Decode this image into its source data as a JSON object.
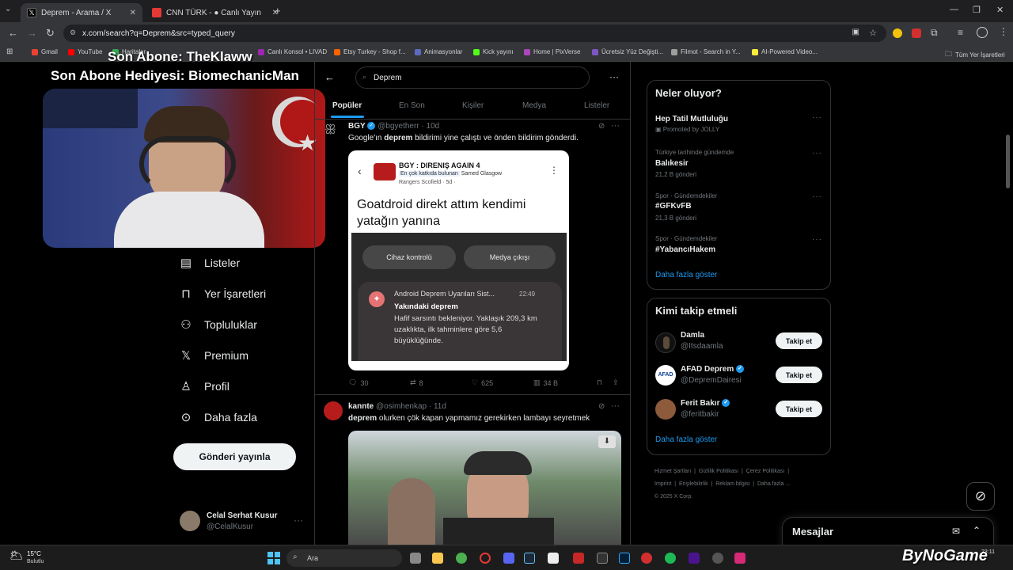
{
  "browser": {
    "tabs": [
      {
        "title": "Deprem - Arama / X",
        "active": true,
        "fav_color": "#000000"
      },
      {
        "title": "CNN TÜRK - ● Canlı Yayın",
        "active": false,
        "fav_color": "#e53935"
      }
    ],
    "url": "x.com/search?q=Deprem&src=typed_query",
    "bookmarks": [
      {
        "label": "Gmail",
        "color": "#ea4335"
      },
      {
        "label": "YouTube",
        "color": "#ff0000"
      },
      {
        "label": "Haritalar",
        "color": "#34a853"
      },
      {
        "label": "Canlı Konsol • LIVAD",
        "color": "#9c27b0"
      },
      {
        "label": "Etsy Turkey - Shop f...",
        "color": "#f56400"
      },
      {
        "label": "Animasyonlar",
        "color": "#5c6bc0"
      },
      {
        "label": "Kick yayını",
        "color": "#53fc18"
      },
      {
        "label": "Home | PixVerse",
        "color": "#ab47bc"
      },
      {
        "label": "Ücretsiz Yüz Değişti...",
        "color": "#7e57c2"
      },
      {
        "label": "Filmot - Search in Y...",
        "color": "#9e9e9e"
      },
      {
        "label": "AI-Powered Video...",
        "color": "#ffeb3b"
      }
    ],
    "all_bookmarks": "Tüm Yer İşaretleri"
  },
  "overlay": {
    "last_sub": "Son Abone: TheKlaww",
    "last_gift": "Son Abone Hediyesi: BiomechanicMan"
  },
  "nav": {
    "items": [
      {
        "label": "Listeler",
        "icon": "list-icon"
      },
      {
        "label": "Yer İşaretleri",
        "icon": "bookmark-icon"
      },
      {
        "label": "Topluluklar",
        "icon": "communities-icon"
      },
      {
        "label": "Premium",
        "icon": "x-logo-icon"
      },
      {
        "label": "Profil",
        "icon": "profile-icon"
      },
      {
        "label": "Daha fazla",
        "icon": "more-circle-icon"
      }
    ],
    "post_button": "Gönderi yayınla",
    "account": {
      "name": "Celal Serhat Kusur",
      "handle": "@CelalKusur"
    }
  },
  "search": {
    "query": "Deprem",
    "tabs": [
      "Popüler",
      "En Son",
      "Kişiler",
      "Medya",
      "Listeler"
    ]
  },
  "tweets": [
    {
      "name": "BGY",
      "handle": "@bgyetherr",
      "time": "· 10d",
      "text_pre": "Google'ın ",
      "text_bold": "deprem",
      "text_post": " bildirimi yine çalıştı ve önden bildirim gönderdi.",
      "embed": {
        "group": "BGY : DIRENIŞ AGAIN 4",
        "badge": "En çok katkıda bulunan",
        "author": "Samed Glasgow",
        "author2": "Rangers Scofield",
        "age": "· 5d ·",
        "headline": "Goatdroid direkt attım kendimi yatağın yanına",
        "btn_left": "Cihaz kontrolü",
        "btn_right": "Medya çıkışı",
        "notif_app": "Android Deprem Uyarıları Sist...",
        "notif_time": "22:49",
        "notif_title": "Yakındaki deprem",
        "notif_body": "Hafif sarsıntı bekleniyor. Yaklaşık 209,3 km uzaklıkta, ilk tahminlere göre 5,6 büyüklüğünde."
      },
      "replies": "30",
      "reposts": "8",
      "likes": "625",
      "views": "34 B"
    },
    {
      "name": "kannte",
      "handle": "@osimhenkap",
      "time": "· 11d",
      "text_bold": "deprem",
      "text_post": " olurken çök kapan yapmamız gerekirken lambayı seyretmek"
    }
  ],
  "trends": {
    "title": "Neler oluyor?",
    "items": [
      {
        "meta": "",
        "name": "Hep Tatil Mutluluğu",
        "extra": "Promoted by JOLLY"
      },
      {
        "meta": "Türkiye tarihinde gündemde",
        "name": "Balıkesir",
        "extra": "21,2 B gönderi"
      },
      {
        "meta": "Spor · Gündemdekiler",
        "name": "#GFKvFB",
        "extra": "21,3 B gönderi"
      },
      {
        "meta": "Spor · Gündemdekiler",
        "name": "#YabancıHakem",
        "extra": ""
      }
    ],
    "show_more": "Daha fazla göster"
  },
  "who_to_follow": {
    "title": "Kimi takip etmeli",
    "items": [
      {
        "name": "Damla",
        "handle": "@Itsdaamla",
        "verified": false,
        "avatar_color": "#5a4a3a"
      },
      {
        "name": "AFAD Deprem",
        "handle": "@DepremDairesi",
        "verified": true,
        "avatar_color": "#ffffff",
        "avatar_text": "AFAD"
      },
      {
        "name": "Ferit Bakır",
        "handle": "@feritbakir",
        "verified": true,
        "avatar_color": "#8d5a3b"
      }
    ],
    "follow_label": "Takip et",
    "show_more": "Daha fazla göster"
  },
  "footer": {
    "links": [
      "Hizmet Şartları",
      "Gizlilik Politikası",
      "Çerez Politikası",
      "Imprint",
      "Erişilebilirlik",
      "Reklam bilgisi",
      "Daha fazla ..."
    ],
    "copyright": "© 2025 X Corp."
  },
  "messages": {
    "label": "Mesajlar"
  },
  "taskbar": {
    "weather_temp": "15°C",
    "weather_desc": "Bulutlu",
    "search": "Ara",
    "clock": "23:11",
    "watermark": "ByNoGame"
  }
}
